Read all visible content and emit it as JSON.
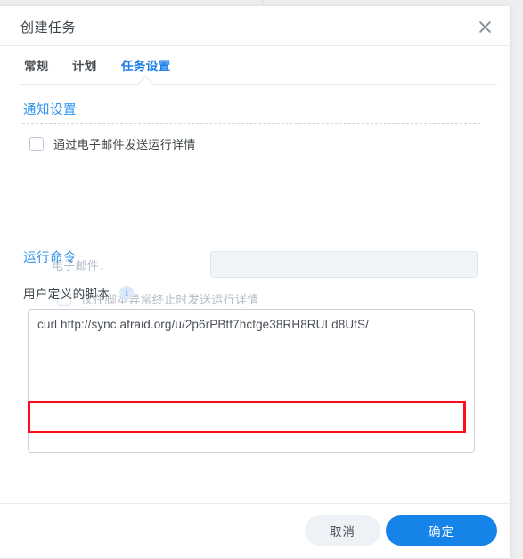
{
  "dialog": {
    "title": "创建任务",
    "close_icon": "close-icon"
  },
  "tabs": [
    {
      "label": "常规",
      "active": false
    },
    {
      "label": "计划",
      "active": false
    },
    {
      "label": "任务设置",
      "active": true
    }
  ],
  "sections": {
    "notification": {
      "title": "通知设置",
      "send_email_checkbox": {
        "label": "通过电子邮件发送运行详情",
        "checked": false,
        "disabled": false
      },
      "email_field": {
        "label": "电子邮件：",
        "value": "",
        "placeholder": "",
        "disabled": true
      },
      "abnormal_only_checkbox": {
        "label": "仅在脚本异常终止时发送运行详情",
        "checked": false,
        "disabled": true
      }
    },
    "run_command": {
      "title": "运行命令",
      "script_label": "用户定义的脚本",
      "info_icon": "info-icon",
      "info_glyph": "i",
      "script_value": "curl http://sync.afraid.org/u/2p6rPBtf7hctge38RH8RULd8UtS/",
      "script_placeholder": ""
    }
  },
  "footer": {
    "cancel_label": "取消",
    "confirm_label": "确定"
  },
  "colors": {
    "accent_blue": "#1583e8",
    "section_title_blue": "#2f93f0",
    "active_tab_blue": "#1c7fe8",
    "annotation_red": "#fc0d1b",
    "disabled_text": "#b2bcc6"
  }
}
